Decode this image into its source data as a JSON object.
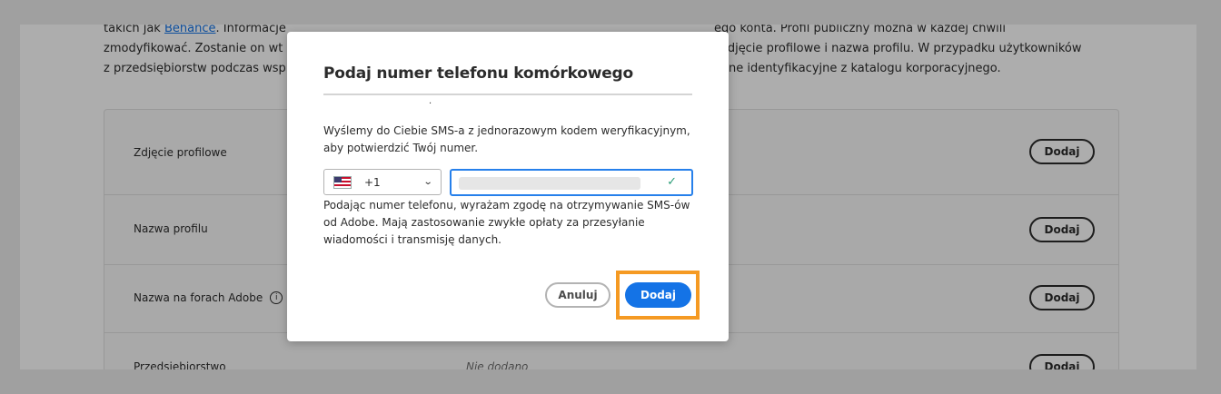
{
  "page": {
    "intro_line1_a": "takich jak ",
    "intro_link": "Behance",
    "intro_line1_b": ". Informacje",
    "intro_line1_c": "ego konta. Profil publiczny można w każdej chwili",
    "intro_line2_a": "zmodyfikować. Zostanie on wt",
    "intro_line2_b": "zdjęcie profilowe i nazwa profilu. W przypadku użytkowników",
    "intro_line3_a": "z przedsiębiorstw podczas wsp",
    "intro_line3_b": "ane identyfikacyjne z katalogu korporacyjnego."
  },
  "profile_rows": [
    {
      "label": "Zdjęcie profilowe",
      "value": "",
      "button": "Dodaj"
    },
    {
      "label": "Nazwa profilu",
      "value": "",
      "button": "Dodaj"
    },
    {
      "label": "Nazwa na forach Adobe",
      "value": "",
      "button": "Dodaj",
      "info_icon": "i"
    },
    {
      "label": "Przedsiębiorstwo",
      "value": "Nie dodano",
      "button": "Dodaj"
    }
  ],
  "modal": {
    "title": "Podaj numer telefonu komórkowego",
    "stray_mark": "·",
    "description": "Wyślemy do Ciebie SMS-a z jednorazowym kodem weryfikacyjnym, aby potwierdzić Twój numer.",
    "country": {
      "flag": "us-flag-icon",
      "dial_code": "+1",
      "chevron": "⌄"
    },
    "phone_value": "",
    "check_mark": "✓",
    "consent": "Podając numer telefonu, wyrażam zgodę na otrzymywanie SMS-ów od Adobe. Mają zastosowanie zwykłe opłaty za przesyłanie wiadomości i transmisję danych.",
    "cancel_label": "Anuluj",
    "submit_label": "Dodaj"
  },
  "colors": {
    "accent": "#1473e6",
    "highlight": "#f59a23",
    "valid": "#2d9d78"
  }
}
